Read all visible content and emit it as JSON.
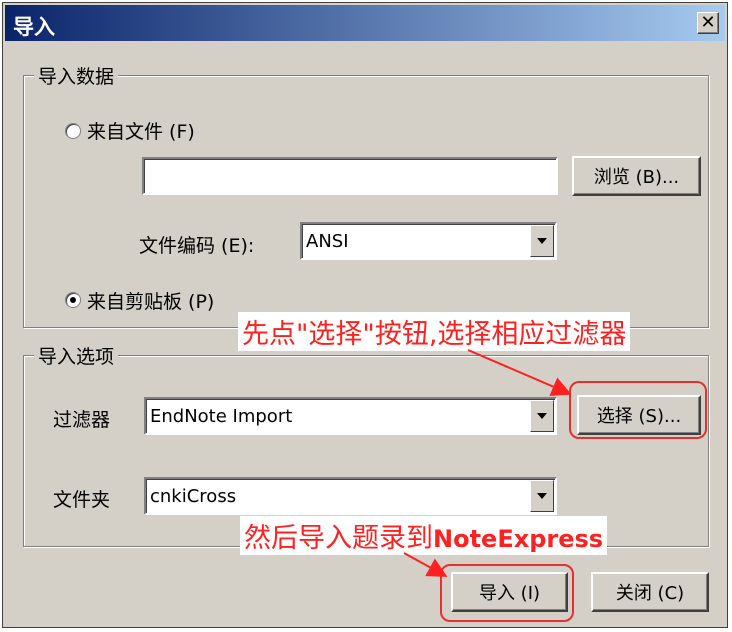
{
  "window": {
    "title": "导入",
    "close_label": "✕"
  },
  "import_data": {
    "legend": "导入数据",
    "from_file_label": "来自文件 (F)",
    "file_path_value": "",
    "browse_label": "浏览 (B)...",
    "encoding_label": "文件编码 (E):",
    "encoding_value": "ANSI",
    "from_clipboard_label": "来自剪贴板 (P)",
    "from_file_selected": false,
    "from_clipboard_selected": true
  },
  "import_options": {
    "legend": "导入选项",
    "filter_label": "过滤器",
    "filter_value": "EndNote Import",
    "select_label": "选择 (S)...",
    "folder_label": "文件夹",
    "folder_value": "cnkiCross"
  },
  "buttons": {
    "import_label": "导入 (I)",
    "close_label": "关闭 (C)"
  },
  "annotations": {
    "note1": "先点\"选择\"按钮,选择相应过滤器",
    "note2_prefix": "然后导入题录到",
    "note2_brand": "NoteExpress",
    "color": "#ff2020"
  }
}
